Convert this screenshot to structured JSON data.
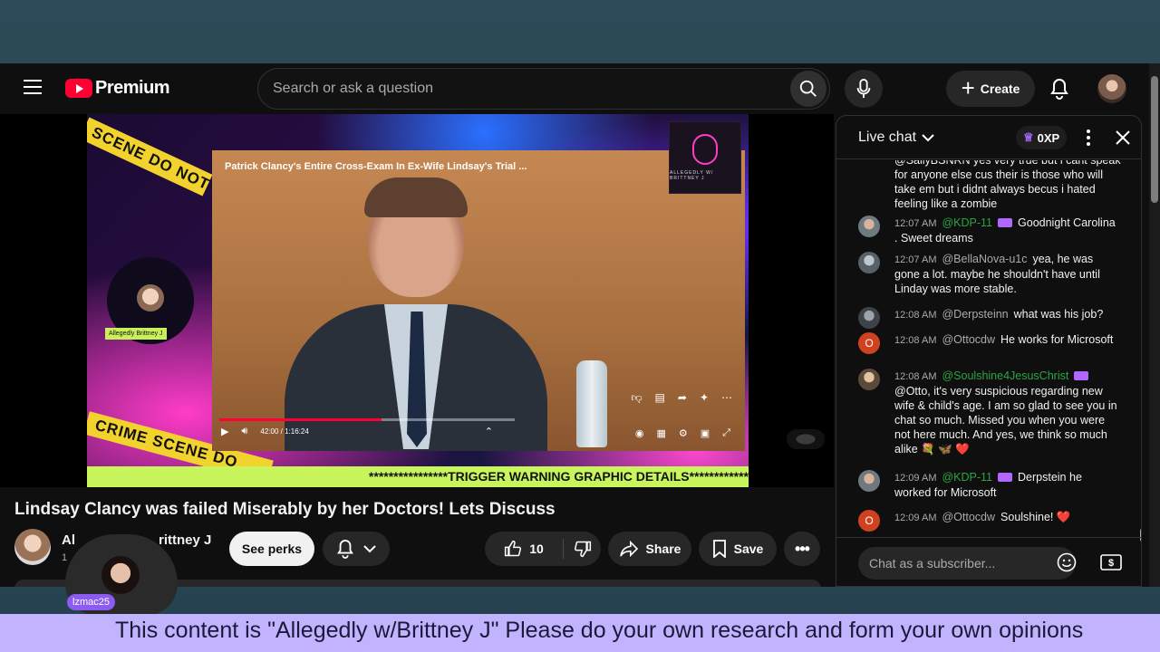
{
  "topbar": {
    "logo_text": "Premium",
    "search_placeholder": "Search or ask a question",
    "create_label": "Create"
  },
  "video": {
    "inner_title": "Patrick Clancy's Entire Cross-Exam In Ex-Wife Lindsay's Trial ...",
    "time_display": "42:00 / 1:16:24",
    "progress_fraction": 0.55,
    "host_tag": "Allegedly Brittney J",
    "podcast_logo_text": "ALLEGEDLY W/ BRITTNEY J",
    "tape_top": "SCENE DO NOT CROSS",
    "tape_bottom": "CRIME SCENE DO",
    "trigger_banner": "****************TRIGGER WARNING GRAPHIC DETAILS************"
  },
  "meta": {
    "title": "Lindsay Clancy was failed Miserably by her Doctors! Lets Discuss",
    "channel_name_left": "Al",
    "channel_name_right": "rittney J",
    "channel_subs": "1",
    "see_perks_label": "See perks",
    "like_count": "10",
    "share_label": "Share",
    "save_label": "Save"
  },
  "chat": {
    "title": "Live chat",
    "xp": "0XP",
    "input_placeholder": "Chat as a subscriber...",
    "messages": [
      {
        "time": "",
        "author": "",
        "text": "@SallyBSNRN yes very true but i cant speak for anyone else cus their is those who will take em but i didnt always becus i hated feeling like a zombie"
      },
      {
        "time": "12:07 AM",
        "author": "@KDP-11",
        "text": "Goodnight Carolina . Sweet dreams"
      },
      {
        "time": "12:07 AM",
        "author": "@BellaNova-u1c",
        "text": "yea, he was gone a lot. maybe he shouldn't have until Linday was more stable."
      },
      {
        "time": "12:08 AM",
        "author": "@Derpsteinn",
        "text": "what was his job?"
      },
      {
        "time": "12:08 AM",
        "author": "@Ottocdw",
        "text": "He works for Microsoft"
      },
      {
        "time": "12:08 AM",
        "author": "@Soulshine4JesusChrist",
        "text": "@Otto, it's very suspicious regarding new wife & child's age. I am so glad to see you in chat so much. Missed you when you were not here much. And yes, we think so much alike 💐 🦋 ❤️"
      },
      {
        "time": "12:09 AM",
        "author": "@KDP-11",
        "text": "Derpstein he worked for Microsoft"
      },
      {
        "time": "12:09 AM",
        "author": "@Ottocdw",
        "text": "Soulshine! ❤️"
      }
    ]
  },
  "overlay": {
    "guest_tag": "lzmac25",
    "bottom_banner": "This content is \"Allegedly w/Brittney J\" Please do your own research and form your own opinions"
  },
  "colors": {
    "youtube_red": "#ff0033",
    "member_green": "#2ba640",
    "banner_lavender": "#c2b3ff",
    "trigger_green": "#c8f55c"
  }
}
